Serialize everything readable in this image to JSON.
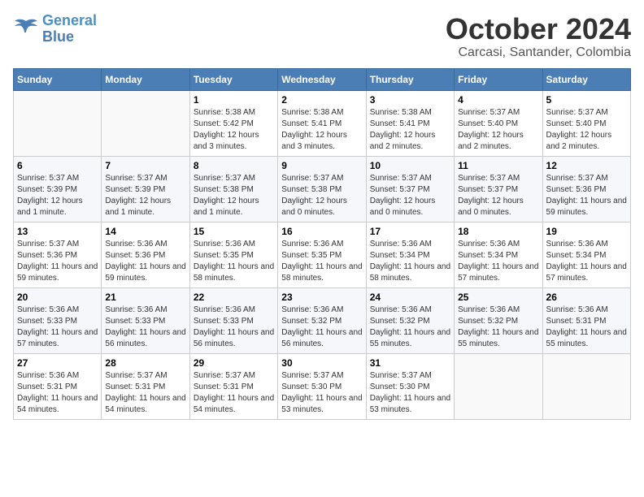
{
  "logo": {
    "line1": "General",
    "line2": "Blue"
  },
  "title": "October 2024",
  "location": "Carcasi, Santander, Colombia",
  "weekdays": [
    "Sunday",
    "Monday",
    "Tuesday",
    "Wednesday",
    "Thursday",
    "Friday",
    "Saturday"
  ],
  "weeks": [
    [
      {
        "day": "",
        "info": ""
      },
      {
        "day": "",
        "info": ""
      },
      {
        "day": "1",
        "info": "Sunrise: 5:38 AM\nSunset: 5:42 PM\nDaylight: 12 hours and 3 minutes."
      },
      {
        "day": "2",
        "info": "Sunrise: 5:38 AM\nSunset: 5:41 PM\nDaylight: 12 hours and 3 minutes."
      },
      {
        "day": "3",
        "info": "Sunrise: 5:38 AM\nSunset: 5:41 PM\nDaylight: 12 hours and 2 minutes."
      },
      {
        "day": "4",
        "info": "Sunrise: 5:37 AM\nSunset: 5:40 PM\nDaylight: 12 hours and 2 minutes."
      },
      {
        "day": "5",
        "info": "Sunrise: 5:37 AM\nSunset: 5:40 PM\nDaylight: 12 hours and 2 minutes."
      }
    ],
    [
      {
        "day": "6",
        "info": "Sunrise: 5:37 AM\nSunset: 5:39 PM\nDaylight: 12 hours and 1 minute."
      },
      {
        "day": "7",
        "info": "Sunrise: 5:37 AM\nSunset: 5:39 PM\nDaylight: 12 hours and 1 minute."
      },
      {
        "day": "8",
        "info": "Sunrise: 5:37 AM\nSunset: 5:38 PM\nDaylight: 12 hours and 1 minute."
      },
      {
        "day": "9",
        "info": "Sunrise: 5:37 AM\nSunset: 5:38 PM\nDaylight: 12 hours and 0 minutes."
      },
      {
        "day": "10",
        "info": "Sunrise: 5:37 AM\nSunset: 5:37 PM\nDaylight: 12 hours and 0 minutes."
      },
      {
        "day": "11",
        "info": "Sunrise: 5:37 AM\nSunset: 5:37 PM\nDaylight: 12 hours and 0 minutes."
      },
      {
        "day": "12",
        "info": "Sunrise: 5:37 AM\nSunset: 5:36 PM\nDaylight: 11 hours and 59 minutes."
      }
    ],
    [
      {
        "day": "13",
        "info": "Sunrise: 5:37 AM\nSunset: 5:36 PM\nDaylight: 11 hours and 59 minutes."
      },
      {
        "day": "14",
        "info": "Sunrise: 5:36 AM\nSunset: 5:36 PM\nDaylight: 11 hours and 59 minutes."
      },
      {
        "day": "15",
        "info": "Sunrise: 5:36 AM\nSunset: 5:35 PM\nDaylight: 11 hours and 58 minutes."
      },
      {
        "day": "16",
        "info": "Sunrise: 5:36 AM\nSunset: 5:35 PM\nDaylight: 11 hours and 58 minutes."
      },
      {
        "day": "17",
        "info": "Sunrise: 5:36 AM\nSunset: 5:34 PM\nDaylight: 11 hours and 58 minutes."
      },
      {
        "day": "18",
        "info": "Sunrise: 5:36 AM\nSunset: 5:34 PM\nDaylight: 11 hours and 57 minutes."
      },
      {
        "day": "19",
        "info": "Sunrise: 5:36 AM\nSunset: 5:34 PM\nDaylight: 11 hours and 57 minutes."
      }
    ],
    [
      {
        "day": "20",
        "info": "Sunrise: 5:36 AM\nSunset: 5:33 PM\nDaylight: 11 hours and 57 minutes."
      },
      {
        "day": "21",
        "info": "Sunrise: 5:36 AM\nSunset: 5:33 PM\nDaylight: 11 hours and 56 minutes."
      },
      {
        "day": "22",
        "info": "Sunrise: 5:36 AM\nSunset: 5:33 PM\nDaylight: 11 hours and 56 minutes."
      },
      {
        "day": "23",
        "info": "Sunrise: 5:36 AM\nSunset: 5:32 PM\nDaylight: 11 hours and 56 minutes."
      },
      {
        "day": "24",
        "info": "Sunrise: 5:36 AM\nSunset: 5:32 PM\nDaylight: 11 hours and 55 minutes."
      },
      {
        "day": "25",
        "info": "Sunrise: 5:36 AM\nSunset: 5:32 PM\nDaylight: 11 hours and 55 minutes."
      },
      {
        "day": "26",
        "info": "Sunrise: 5:36 AM\nSunset: 5:31 PM\nDaylight: 11 hours and 55 minutes."
      }
    ],
    [
      {
        "day": "27",
        "info": "Sunrise: 5:36 AM\nSunset: 5:31 PM\nDaylight: 11 hours and 54 minutes."
      },
      {
        "day": "28",
        "info": "Sunrise: 5:37 AM\nSunset: 5:31 PM\nDaylight: 11 hours and 54 minutes."
      },
      {
        "day": "29",
        "info": "Sunrise: 5:37 AM\nSunset: 5:31 PM\nDaylight: 11 hours and 54 minutes."
      },
      {
        "day": "30",
        "info": "Sunrise: 5:37 AM\nSunset: 5:30 PM\nDaylight: 11 hours and 53 minutes."
      },
      {
        "day": "31",
        "info": "Sunrise: 5:37 AM\nSunset: 5:30 PM\nDaylight: 11 hours and 53 minutes."
      },
      {
        "day": "",
        "info": ""
      },
      {
        "day": "",
        "info": ""
      }
    ]
  ]
}
